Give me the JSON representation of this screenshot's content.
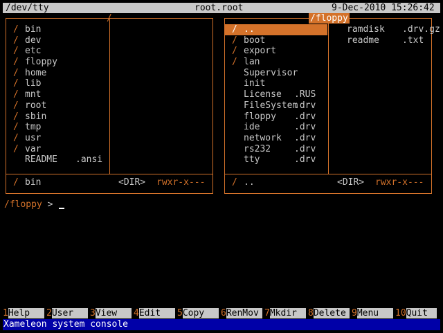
{
  "topbar": {
    "path": "/dev/tty",
    "user": "root.root",
    "datetime": "9-Dec-2010 15:26:42"
  },
  "left_panel": {
    "title_tick": "/",
    "items": [
      {
        "mark": "/",
        "name": "bin",
        "ext": ""
      },
      {
        "mark": "/",
        "name": "dev",
        "ext": ""
      },
      {
        "mark": "/",
        "name": "etc",
        "ext": ""
      },
      {
        "mark": "/",
        "name": "floppy",
        "ext": ""
      },
      {
        "mark": "/",
        "name": "home",
        "ext": ""
      },
      {
        "mark": "/",
        "name": "lib",
        "ext": ""
      },
      {
        "mark": "/",
        "name": "mnt",
        "ext": ""
      },
      {
        "mark": "/",
        "name": "root",
        "ext": ""
      },
      {
        "mark": "/",
        "name": "sbin",
        "ext": ""
      },
      {
        "mark": "/",
        "name": "tmp",
        "ext": ""
      },
      {
        "mark": "/",
        "name": "usr",
        "ext": ""
      },
      {
        "mark": "/",
        "name": "var",
        "ext": ""
      },
      {
        "mark": "",
        "name": "README",
        "ext": ".ansi"
      }
    ],
    "status": {
      "mark": "/",
      "name": "bin",
      "type": "<DIR>",
      "perm": "rwxr-x---"
    }
  },
  "right_panel": {
    "title": "/floppy",
    "items": [
      {
        "mark": "/",
        "name": "..",
        "ext": "",
        "selected": true
      },
      {
        "mark": "/",
        "name": "boot",
        "ext": ""
      },
      {
        "mark": "/",
        "name": "export",
        "ext": ""
      },
      {
        "mark": "/",
        "name": "lan",
        "ext": ""
      },
      {
        "mark": "",
        "name": "Supervisor",
        "ext": ""
      },
      {
        "mark": "",
        "name": "init",
        "ext": ""
      },
      {
        "mark": "",
        "name": "License",
        "ext": ".RUS"
      },
      {
        "mark": "",
        "name": "FileSystem",
        "ext": ".drv"
      },
      {
        "mark": "",
        "name": "floppy",
        "ext": ".drv"
      },
      {
        "mark": "",
        "name": "ide",
        "ext": ".drv"
      },
      {
        "mark": "",
        "name": "network",
        "ext": ".drv"
      },
      {
        "mark": "",
        "name": "rs232",
        "ext": ".drv"
      },
      {
        "mark": "",
        "name": "tty",
        "ext": ".drv"
      }
    ],
    "items_col2": [
      {
        "name": "ramdisk",
        "ext": ".drv.gz"
      },
      {
        "name": "readme",
        "ext": ".txt"
      }
    ],
    "status": {
      "mark": "/",
      "name": "..",
      "type": "<DIR>",
      "perm": "rwxr-x---"
    }
  },
  "command": {
    "path": "/floppy",
    "prompt": " > "
  },
  "fkeys": [
    {
      "num": "1",
      "label": "Help"
    },
    {
      "num": "2",
      "label": "User"
    },
    {
      "num": "3",
      "label": "View"
    },
    {
      "num": "4",
      "label": "Edit"
    },
    {
      "num": "5",
      "label": "Copy"
    },
    {
      "num": "6",
      "label": "RenMov"
    },
    {
      "num": "7",
      "label": "Mkdir"
    },
    {
      "num": "8",
      "label": "Delete"
    },
    {
      "num": "9",
      "label": "Menu"
    },
    {
      "num": "10",
      "label": "Quit"
    }
  ],
  "console": "Xameleon system console",
  "colors": {
    "accent": "#d4722a",
    "bar": "#c8c8c8",
    "console_bg": "#0000a8"
  }
}
